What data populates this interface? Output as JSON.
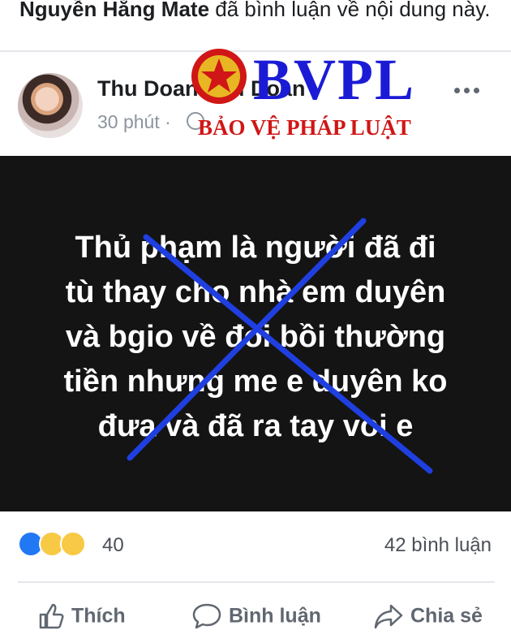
{
  "notice": {
    "actor": "Nguyễn Hằng Mate",
    "text": " đã bình luận về nội dung này."
  },
  "post": {
    "author": "Thu Doan Thu Doan",
    "time": "30 phút ·",
    "image_text": [
      "Thủ phạm là người đã đi",
      "tù thay cho nhà em duyên",
      "và bgio về đòi bồi thường",
      "tiền nhưng me e duyên ko",
      "đưa và đã ra tay voi e"
    ]
  },
  "watermark": {
    "brand": "BVPL",
    "tagline": "BẢO VỆ PHÁP LUẬT"
  },
  "stats": {
    "reaction_count": "40",
    "comments": "42 bình luận"
  },
  "actions": {
    "like": "Thích",
    "comment": "Bình luận",
    "share": "Chia sẻ"
  },
  "icons": [
    "like-icon",
    "comment-icon",
    "share-icon",
    "globe-icon",
    "more-icon"
  ],
  "colors": {
    "cross": "#1f3fe0",
    "brand_blue": "#1b1bd6",
    "brand_red": "#d01616",
    "image_bg": "#141414"
  }
}
